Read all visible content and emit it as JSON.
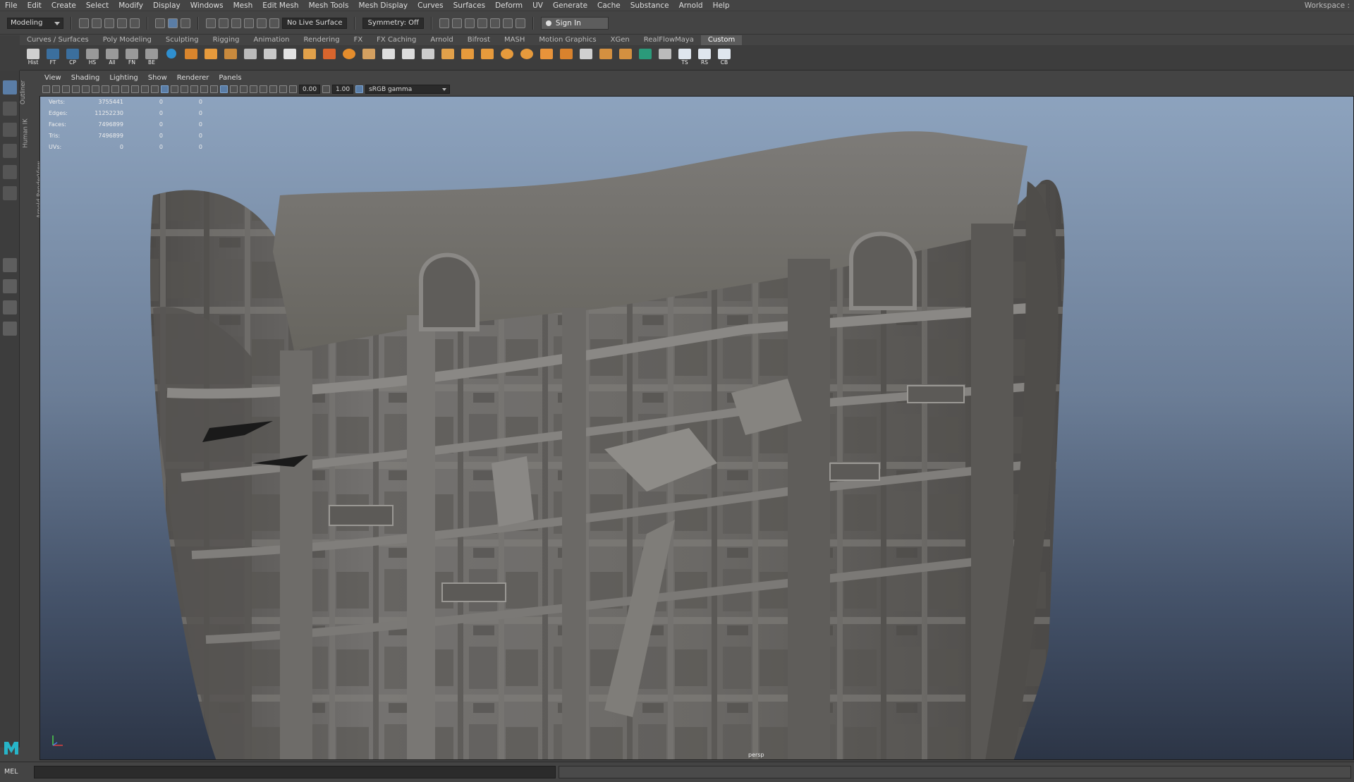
{
  "menubar": {
    "items": [
      "File",
      "Edit",
      "Create",
      "Select",
      "Modify",
      "Display",
      "Windows",
      "Mesh",
      "Edit Mesh",
      "Mesh Tools",
      "Mesh Display",
      "Curves",
      "Surfaces",
      "Deform",
      "UV",
      "Generate",
      "Cache",
      "Substance",
      "Arnold",
      "Help"
    ],
    "workspace": "Workspace :"
  },
  "statusline": {
    "mode": "Modeling",
    "live_surface": "No Live Surface",
    "symmetry": "Symmetry: Off",
    "sign_in": "Sign In"
  },
  "shelf": {
    "tabs": [
      "Curves / Surfaces",
      "Poly Modeling",
      "Sculpting",
      "Rigging",
      "Animation",
      "Rendering",
      "FX",
      "FX Caching",
      "Arnold",
      "Bifrost",
      "MASH",
      "Motion Graphics",
      "XGen",
      "RealFlowMaya",
      "Custom"
    ],
    "active_tab": "Custom",
    "labeled_icons": [
      "Hist",
      "FT",
      "CP",
      "HS",
      "All",
      "FN",
      "BE"
    ],
    "end_icons": [
      "TS",
      "RS",
      "CB"
    ]
  },
  "side_tabs": [
    "Outliner",
    "Human IK",
    "Arnold RenderView"
  ],
  "panel": {
    "menu": [
      "View",
      "Shading",
      "Lighting",
      "Show",
      "Renderer",
      "Panels"
    ],
    "exposure": "0.00",
    "gamma": "1.00",
    "color_management": "sRGB gamma"
  },
  "hud": [
    {
      "label": "Verts:",
      "value": "3755441",
      "sel1": "0",
      "sel2": "0"
    },
    {
      "label": "Edges:",
      "value": "11252230",
      "sel1": "0",
      "sel2": "0"
    },
    {
      "label": "Faces:",
      "value": "7496899",
      "sel1": "0",
      "sel2": "0"
    },
    {
      "label": "Tris:",
      "value": "7496899",
      "sel1": "0",
      "sel2": "0"
    },
    {
      "label": "UVs:",
      "value": "0",
      "sel1": "0",
      "sel2": "0"
    }
  ],
  "camera_label": "persp",
  "command_line": {
    "language": "MEL"
  },
  "colors": {
    "accent": "#5a7da6",
    "viewport_top": "#8da3be",
    "viewport_bottom": "#2c3546",
    "model": "#6f6d6a"
  }
}
